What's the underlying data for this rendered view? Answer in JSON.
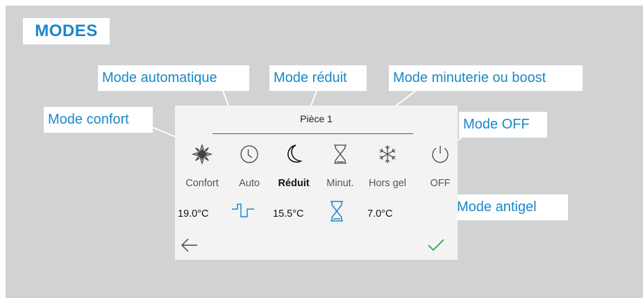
{
  "header": {
    "title": "MODES"
  },
  "callouts": {
    "automatique": "Mode automatique",
    "reduit": "Mode réduit",
    "minuterie": "Mode minuterie ou boost",
    "confort": "Mode confort",
    "off": "Mode OFF",
    "antigel": "Mode antigel"
  },
  "screen": {
    "room_title": "Pièce 1",
    "modes": [
      {
        "label": "Confort",
        "icon": "sun-icon"
      },
      {
        "label": "Auto",
        "icon": "clock-icon"
      },
      {
        "label": "Réduit",
        "icon": "moon-icon",
        "selected": true
      },
      {
        "label": "Minut.",
        "icon": "hourglass-icon"
      },
      {
        "label": "Hors gel",
        "icon": "snowflake-icon"
      },
      {
        "label": "OFF",
        "icon": "power-icon"
      }
    ],
    "values": {
      "confort": "19.0°C",
      "reduit": "15.5°C",
      "hors_gel": "7.0°C"
    },
    "status_icons": [
      "schedule-icon",
      "hourglass-active-icon"
    ],
    "footer": {
      "back_icon": "back-arrow-icon",
      "confirm_icon": "check-icon"
    }
  },
  "colors": {
    "accent": "#1b87c9",
    "background": "#d1d2d3",
    "screen": "#f3f3f3",
    "confirm": "#2aa84a"
  }
}
